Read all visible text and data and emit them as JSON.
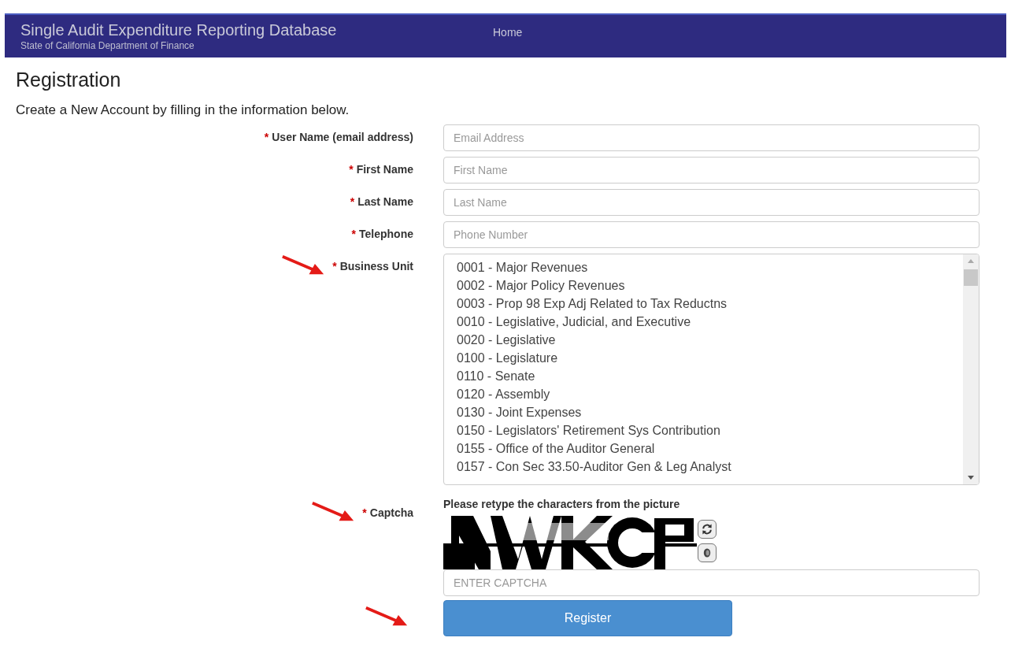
{
  "header": {
    "title": "Single Audit Expenditure Reporting Database",
    "subtitle": "State of California Department of Finance",
    "nav": [
      {
        "label": "Home"
      }
    ]
  },
  "page": {
    "heading": "Registration",
    "intro": "Create a New Account by filling in the information below."
  },
  "fields": [
    {
      "kind": "input",
      "marker": "*",
      "label": "User Name (email address)",
      "placeholder": "Email Address",
      "arrow": false
    },
    {
      "kind": "input",
      "marker": "*",
      "label": "First Name",
      "placeholder": "First Name",
      "arrow": false
    },
    {
      "kind": "input",
      "marker": "*",
      "label": "Last Name",
      "placeholder": "Last Name",
      "arrow": false
    },
    {
      "kind": "input",
      "marker": "*",
      "label": "Telephone",
      "placeholder": "Phone Number",
      "arrow": false
    },
    {
      "kind": "listbox",
      "marker": "*",
      "label": "Business Unit",
      "arrow": true,
      "options": [
        "0001 - Major Revenues",
        "0002 - Major Policy Revenues",
        "0003 - Prop 98 Exp Adj Related to Tax Reductns",
        "0010 - Legislative, Judicial, and Executive",
        "0020 - Legislative",
        "0100 - Legislature",
        "0110 - Senate",
        "0120 - Assembly",
        "0130 - Joint Expenses",
        "0150 - Legislators' Retirement Sys Contribution",
        "0155 - Office of the Auditor General",
        "0157 - Con Sec 33.50-Auditor Gen & Leg Analyst"
      ]
    },
    {
      "kind": "captcha",
      "marker": "*",
      "label": "Captcha",
      "arrow": true,
      "instruction": "Please retype the characters from the picture",
      "placeholder": "ENTER CAPTCHA"
    }
  ],
  "submit": {
    "label": "Register",
    "arrow": true
  }
}
